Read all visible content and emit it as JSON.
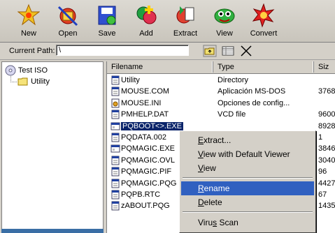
{
  "toolbar": {
    "new": "New",
    "open": "Open",
    "save": "Save",
    "add": "Add",
    "extract": "Extract",
    "view": "View",
    "convert": "Convert"
  },
  "pathbar": {
    "label": "Current Path:",
    "value": "\\"
  },
  "tree": {
    "root": "Test ISO",
    "child": "Utility"
  },
  "filelist": {
    "columns": [
      "Filename",
      "Type",
      "Siz"
    ],
    "rows": [
      {
        "name": "Utility",
        "type": "Directory",
        "size": "",
        "icon": "file-icon"
      },
      {
        "name": "MOUSE.COM",
        "type": "Aplicación MS-DOS",
        "size": "3768",
        "icon": "file-icon"
      },
      {
        "name": "MOUSE.INI",
        "type": "Opciones de config...",
        "size": "",
        "icon": "settings-file-icon"
      },
      {
        "name": "PMHELP.DAT",
        "type": "VCD file",
        "size": "9600",
        "icon": "file-icon"
      },
      {
        "name": "PQBOOT<>.EXE",
        "type": "",
        "size": "8928",
        "icon": "exe-icon"
      },
      {
        "name": "PQDATA.002",
        "type": "",
        "size": "1",
        "icon": "file-icon"
      },
      {
        "name": "PQMAGIC.EXE",
        "type": "",
        "size": "3846",
        "icon": "exe-icon"
      },
      {
        "name": "PQMAGIC.OVL",
        "type": "",
        "size": "3040",
        "icon": "file-icon"
      },
      {
        "name": "PQMAGIC.PIF",
        "type": "",
        "size": "96",
        "icon": "file-icon"
      },
      {
        "name": "PQMAGIC.PQG",
        "type": "",
        "size": "4427",
        "icon": "file-icon"
      },
      {
        "name": "PQPB.RTC",
        "type": "",
        "size": "67",
        "icon": "file-icon"
      },
      {
        "name": "zABOUT.PQG",
        "type": "",
        "size": "1435",
        "icon": "file-icon"
      }
    ]
  },
  "context_menu": {
    "extract": "Extract...",
    "view_default": "View with Default Viewer",
    "view": "View",
    "rename": "Rename",
    "delete": "Delete",
    "virus_scan": "Virus Scan"
  },
  "colors": {
    "selection": "#0a246a",
    "menu_highlight": "#3060c0"
  }
}
